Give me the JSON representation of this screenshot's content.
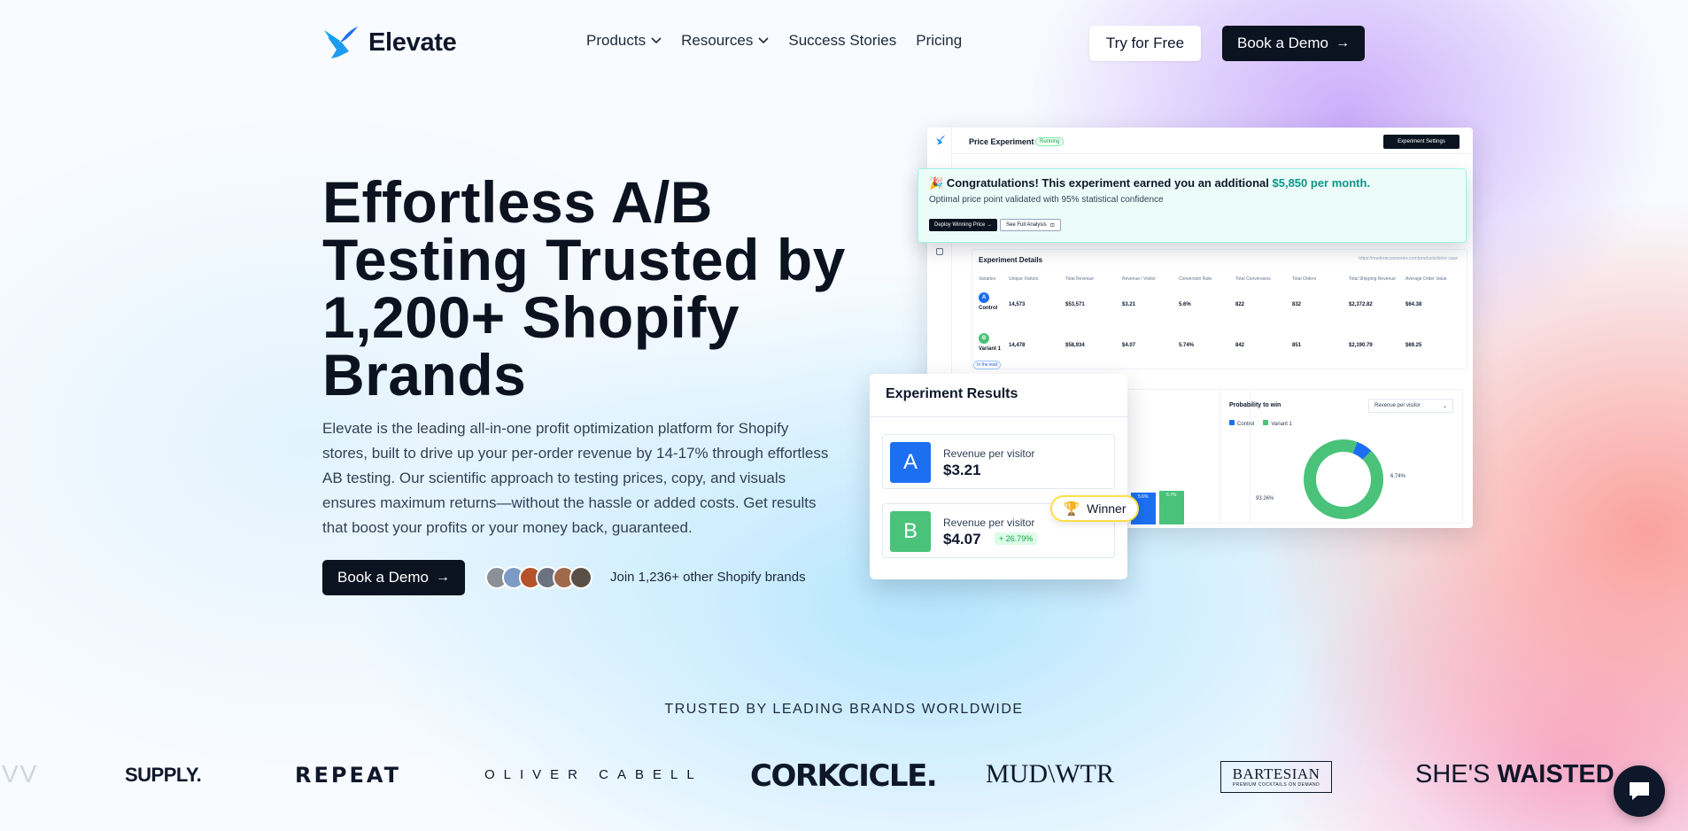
{
  "brand": {
    "name": "Elevate",
    "accent": "#1d9bf0"
  },
  "nav": {
    "items": [
      {
        "label": "Products",
        "has_dropdown": true
      },
      {
        "label": "Resources",
        "has_dropdown": true
      },
      {
        "label": "Success Stories",
        "has_dropdown": false
      },
      {
        "label": "Pricing",
        "has_dropdown": false
      }
    ],
    "try_free": "Try for Free",
    "book_demo": "Book a Demo"
  },
  "hero": {
    "title": "Effortless A/B Testing Trusted by 1,200+ Shopify Brands",
    "description": "Elevate is the leading all-in-one profit optimization platform for Shopify stores, built to drive up your per-order revenue by 14-17% through effortless AB testing. Our scientific approach to testing prices, copy, and visuals ensures maximum returns—without the hassle or added costs. Get results that boost your profits or your money back, guaranteed.",
    "cta": "Book a Demo",
    "social_proof": "Join 1,236+ other Shopify brands"
  },
  "dashboard": {
    "title": "Price Experiment",
    "status": "Running",
    "settings_button": "Experiment Settings",
    "congrats": {
      "text": "Congratulations! This experiment earned you an additional",
      "amount": "$5,850 per month.",
      "subtext": "Optimal price point validated with 95% statistical confidence",
      "deploy_button": "Deploy Winning Price →",
      "analysis_button": "See Full Analysis"
    },
    "details": {
      "title": "Experiment Details",
      "url": "https://maderaccessories.com/products/dolor-case",
      "columns": [
        "Variation",
        "Unique Visitors",
        "Total Revenue",
        "Revenue / Visitor",
        "Conversion Rate",
        "Total Conversions",
        "Total Orders",
        "Total Shipping Revenue",
        "Average Order Value"
      ],
      "rows": [
        {
          "name": "Control",
          "letter": "A",
          "values": [
            "14,573",
            "$53,571",
            "$3.21",
            "5.6%",
            "822",
            "832",
            "$2,372.82",
            "$64.38"
          ]
        },
        {
          "name": "Variant 1",
          "letter": "B",
          "values": [
            "14,478",
            "$58,934",
            "$4.07",
            "5.74%",
            "842",
            "851",
            "$2,190.79",
            "$69.25"
          ],
          "pill": "In the lead"
        }
      ]
    },
    "bars": {
      "labels": [
        "5.6%",
        "5.7%"
      ]
    },
    "probability": {
      "title": "Probability to win",
      "select": "Revenue per visitor",
      "legend": [
        "Control",
        "Variant 1"
      ],
      "values": [
        6.74,
        93.26
      ],
      "labels": [
        "6.74%",
        "93.26%"
      ],
      "colors": [
        "#1d6ff2",
        "#4ac27a"
      ]
    }
  },
  "results": {
    "title": "Experiment Results",
    "winner": "Winner",
    "variants": [
      {
        "letter": "A",
        "label": "Revenue per visitor",
        "value": "$3.21",
        "color": "#1d6ff2"
      },
      {
        "letter": "B",
        "label": "Revenue per visitor",
        "value": "$4.07",
        "delta": "+ 26.79%",
        "color": "#4ac27a"
      }
    ]
  },
  "trusted": {
    "heading": "TRUSTED BY LEADING BRANDS WORLDWIDE",
    "brands": [
      "VV",
      "SUPPLY.",
      "REPEAT",
      "OLIVER CABELL",
      "CORKCICLE.",
      "MUD\\WTR",
      "BARTESIAN",
      "PREMIUM COCKTAILS ON DEMAND",
      "SHE'S",
      "WAISTED"
    ]
  }
}
